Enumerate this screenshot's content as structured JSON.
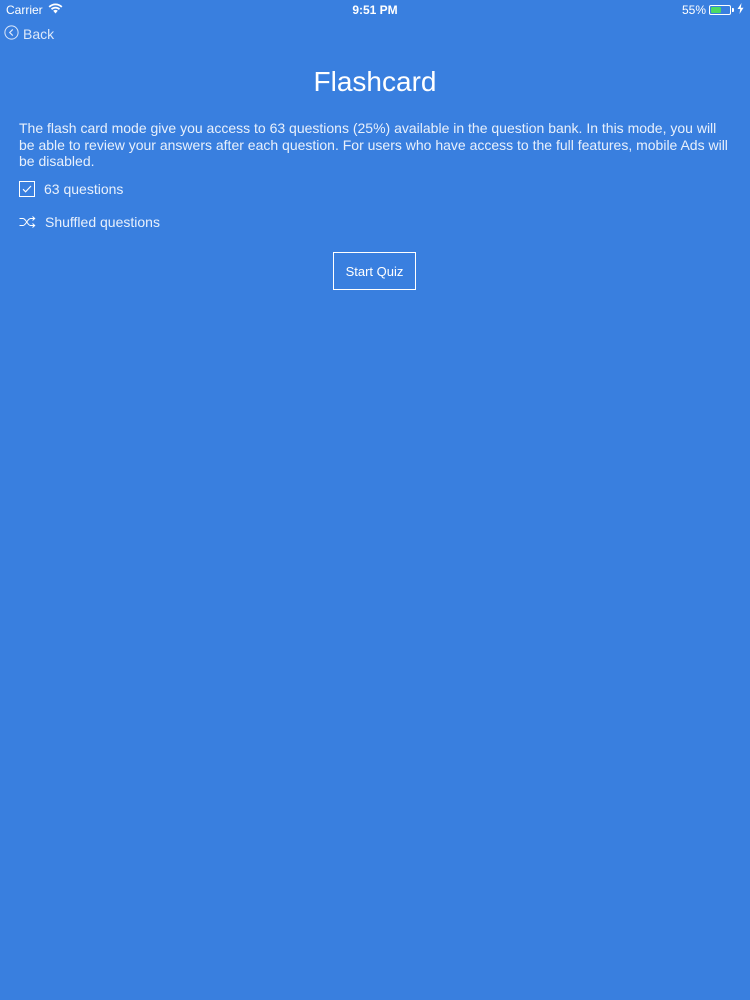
{
  "status_bar": {
    "carrier": "Carrier",
    "time": "9:51 PM",
    "battery_percent": "55%",
    "battery_level": 0.55,
    "icons": [
      "wifi-icon",
      "battery-icon",
      "charging-bolt-icon"
    ]
  },
  "nav": {
    "back_label": "Back",
    "back_icon": "chevron-left-circle-icon"
  },
  "page": {
    "title": "Flashcard",
    "description": "The flash card mode give you access to 63 questions (25%) available in the question bank. In this mode, you will be able to review your answers after each question. For users who have access to the full features, mobile Ads will be disabled."
  },
  "options": [
    {
      "icon": "checkbox-checked-icon",
      "label": "63 questions"
    },
    {
      "icon": "shuffle-icon",
      "label": "Shuffled questions"
    }
  ],
  "actions": {
    "start_label": "Start Quiz"
  },
  "colors": {
    "background": "#397fdf",
    "text": "#ffffff",
    "battery_fill": "#4cd964"
  }
}
